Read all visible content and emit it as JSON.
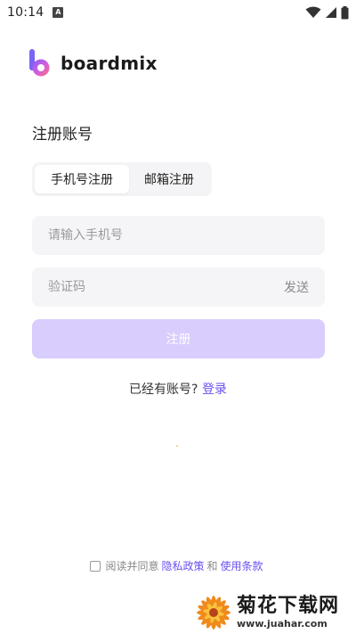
{
  "status_bar": {
    "time": "10:14",
    "notification_icon": "A"
  },
  "brand": {
    "name": "boardmix",
    "logo_icon": "boardmix-logo-icon"
  },
  "page": {
    "title": "注册账号"
  },
  "tabs": [
    {
      "label": "手机号注册",
      "active": true
    },
    {
      "label": "邮箱注册",
      "active": false
    }
  ],
  "form": {
    "phone_placeholder": "请输入手机号",
    "code_placeholder": "验证码",
    "send_label": "发送",
    "submit_label": "注册"
  },
  "login": {
    "prompt": "已经有账号?",
    "link": "登录"
  },
  "agreement": {
    "prefix": "阅读并同意",
    "privacy": "隐私政策",
    "and": "和",
    "terms": "使用条款"
  },
  "watermark": {
    "name": "菊花下载网",
    "url": "www.juahar.com"
  },
  "colors": {
    "accent": "#6a4ff0",
    "submit_disabled": "#d8cdfc",
    "field_bg": "#f5f5f7"
  }
}
